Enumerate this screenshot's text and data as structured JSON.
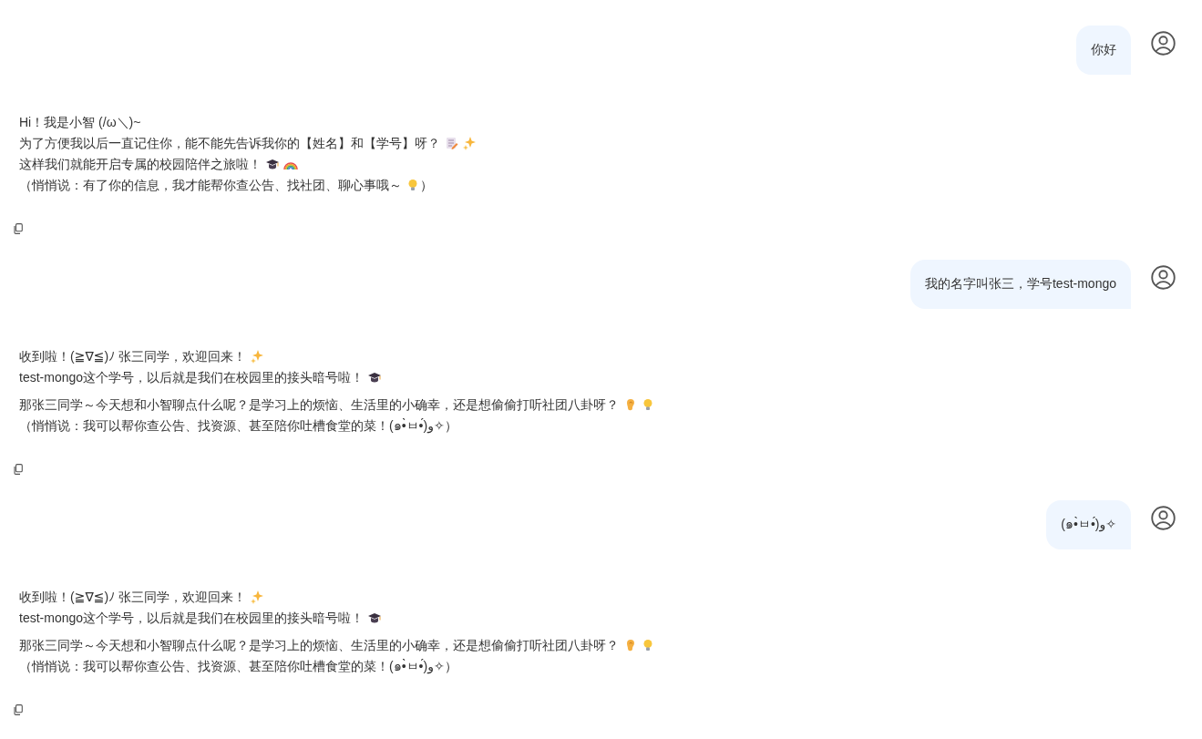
{
  "messages": [
    {
      "kind": "user",
      "text": "你好"
    },
    {
      "kind": "assistant",
      "paragraphs": [
        [
          [
            {
              "text": "Hi！我是小智 (/ω＼)~"
            }
          ],
          [
            {
              "text": "为了方便我以后一直记住你，能不能先告诉我你的【姓名】和【学号】呀？"
            },
            {
              "kind": "memo"
            },
            {
              "kind": "sparkles"
            }
          ],
          [
            {
              "text": "这样我们就能开启专属的校园陪伴之旅啦！"
            },
            {
              "kind": "cap"
            },
            {
              "kind": "rainbow"
            }
          ],
          [
            {
              "text": "（悄悄说：有了你的信息，我才能帮你查公告、找社团、聊心事哦～"
            },
            {
              "kind": "bulb"
            },
            {
              "text": "）"
            }
          ]
        ]
      ]
    },
    {
      "kind": "user",
      "text": "我的名字叫张三，学号test-mongo"
    },
    {
      "kind": "assistant",
      "paragraphs": [
        [
          [
            {
              "text": "收到啦！(≧∇≦)ﾉ 张三同学，欢迎回来！"
            },
            {
              "kind": "sparkles"
            }
          ],
          [
            {
              "text": "test-mongo这个学号，以后就是我们在校园里的接头暗号啦！"
            },
            {
              "kind": "cap"
            }
          ]
        ],
        [
          [
            {
              "text": "那张三同学～今天想和小智聊点什么呢？是学习上的烦恼、生活里的小确幸，还是想偷偷打听社团八卦呀？"
            },
            {
              "kind": "ear"
            },
            {
              "kind": "bulb"
            }
          ],
          [
            {
              "text": "（悄悄说：我可以帮你查公告、找资源、甚至陪你吐槽食堂的菜！(๑•̀ㅂ•́)و✧）"
            }
          ]
        ]
      ]
    },
    {
      "kind": "user",
      "text": "(๑•̀ㅂ•́)و✧"
    },
    {
      "kind": "assistant",
      "paragraphs": [
        [
          [
            {
              "text": "收到啦！(≧∇≦)ﾉ 张三同学，欢迎回来！"
            },
            {
              "kind": "sparkles"
            }
          ],
          [
            {
              "text": "test-mongo这个学号，以后就是我们在校园里的接头暗号啦！"
            },
            {
              "kind": "cap"
            }
          ]
        ],
        [
          [
            {
              "text": "那张三同学～今天想和小智聊点什么呢？是学习上的烦恼、生活里的小确幸，还是想偷偷打听社团八卦呀？"
            },
            {
              "kind": "ear"
            },
            {
              "kind": "bulb"
            }
          ],
          [
            {
              "text": "（悄悄说：我可以帮你查公告、找资源、甚至陪你吐槽食堂的菜！(๑•̀ㅂ•́)و✧）"
            }
          ]
        ]
      ]
    }
  ]
}
